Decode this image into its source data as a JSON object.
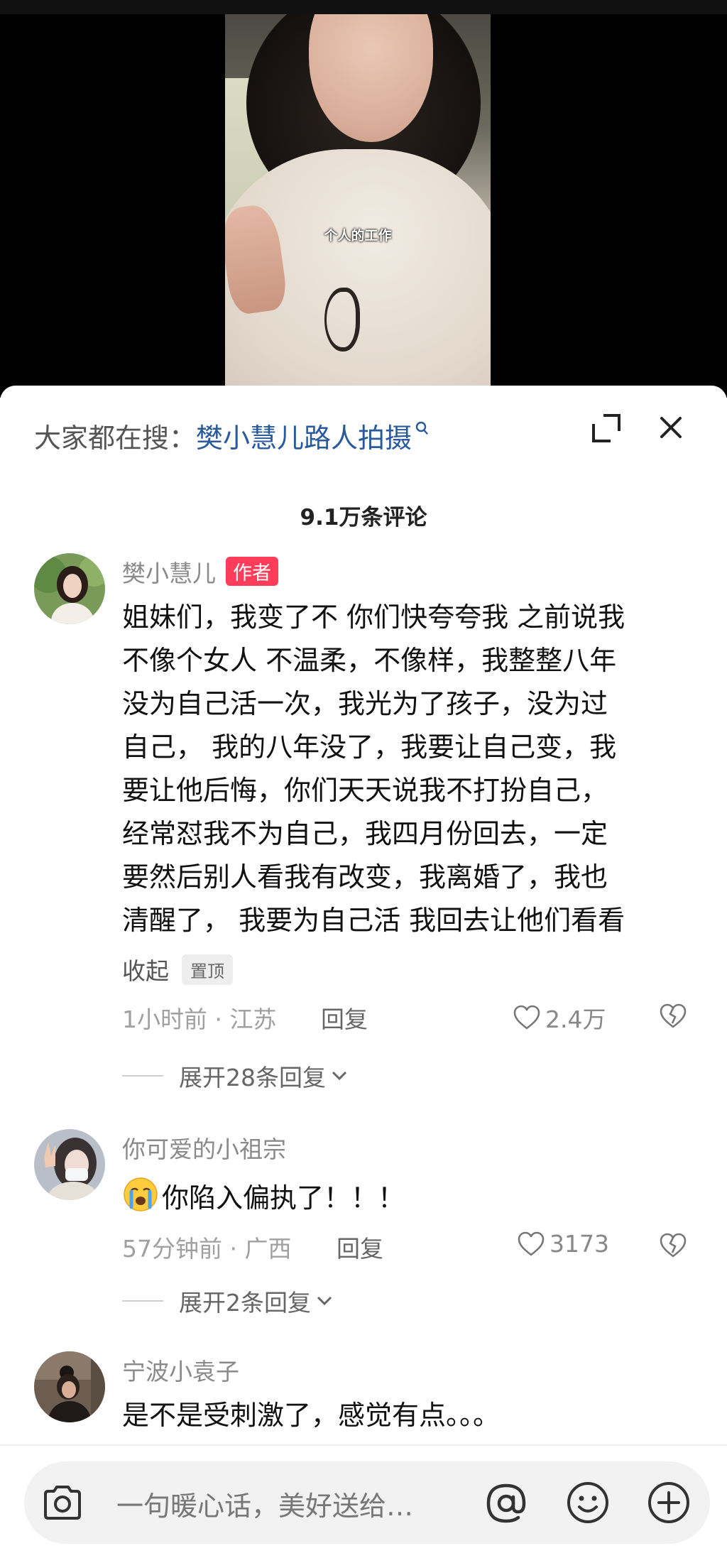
{
  "video": {
    "subtitle": "个人的工作"
  },
  "search_suggest": {
    "prefix": "大家都在搜：",
    "term": "樊小慧儿路人拍摄"
  },
  "comments_header": {
    "count": "9.1万条评论"
  },
  "comments": [
    {
      "username": "樊小慧儿",
      "tag": "作者",
      "text_lines": [
        "姐妹们，我变了不 你们快夸夸我 之前说我",
        "不像个女人 不温柔，不像样，我整整八年",
        "没为自己活一次，我光为了孩子，没为过",
        "自己， 我的八年没了，我要让自己变，我",
        "要让他后悔，你们天天说我不打扮自己，",
        "经常怼我不为自己，我四月份回去，一定",
        "要然后别人看我有改变，我离婚了，我也",
        "清醒了， 我要为自己活 我回去让他们看看"
      ],
      "collapse_label": "收起",
      "pinned_label": "置顶",
      "meta": "1小时前 · 江苏",
      "reply_label": "回复",
      "likes": "2.4万",
      "expand_replies": "展开28条回复"
    },
    {
      "username": "你可爱的小祖宗",
      "text": "你陷入偏执了！！！",
      "meta": "57分钟前 · 广西",
      "reply_label": "回复",
      "likes": "3173",
      "expand_replies": "展开2条回复"
    },
    {
      "username": "宁波小袁子",
      "text": "是不是受刺激了，感觉有点。。。"
    }
  ],
  "input_bar": {
    "placeholder": "一句暖心话，美好送给…"
  },
  "colors": {
    "author_tag": "#ff3d5b",
    "search_term": "#2a5a9e"
  }
}
